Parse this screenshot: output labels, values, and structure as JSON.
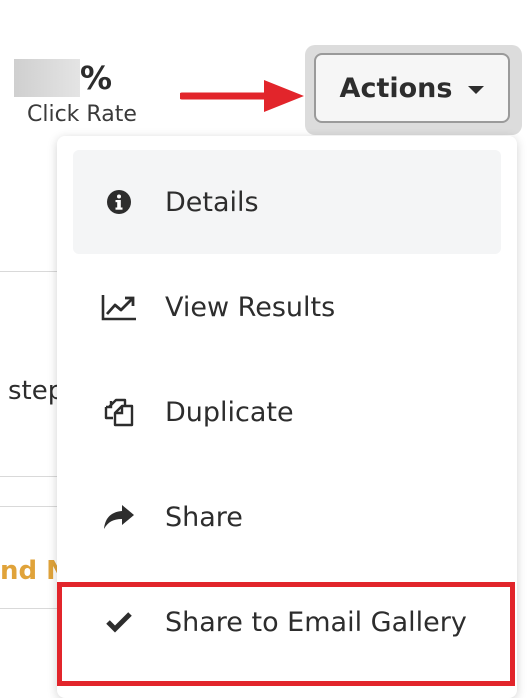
{
  "stat": {
    "value_suffix": "%",
    "label": "Click Rate"
  },
  "actions": {
    "label": "Actions"
  },
  "background": {
    "text_partial": "step",
    "link_partial": "nd N"
  },
  "menu": {
    "items": [
      {
        "label": "Details",
        "icon": "info-circle-icon"
      },
      {
        "label": "View Results",
        "icon": "line-chart-icon"
      },
      {
        "label": "Duplicate",
        "icon": "duplicate-icon"
      },
      {
        "label": "Share",
        "icon": "share-arrow-icon"
      },
      {
        "label": "Share to Email Gallery",
        "icon": "checkmark-icon"
      }
    ]
  },
  "colors": {
    "highlight": "#e2252b",
    "arrow": "#e2252b",
    "link": "#e0a33a"
  }
}
